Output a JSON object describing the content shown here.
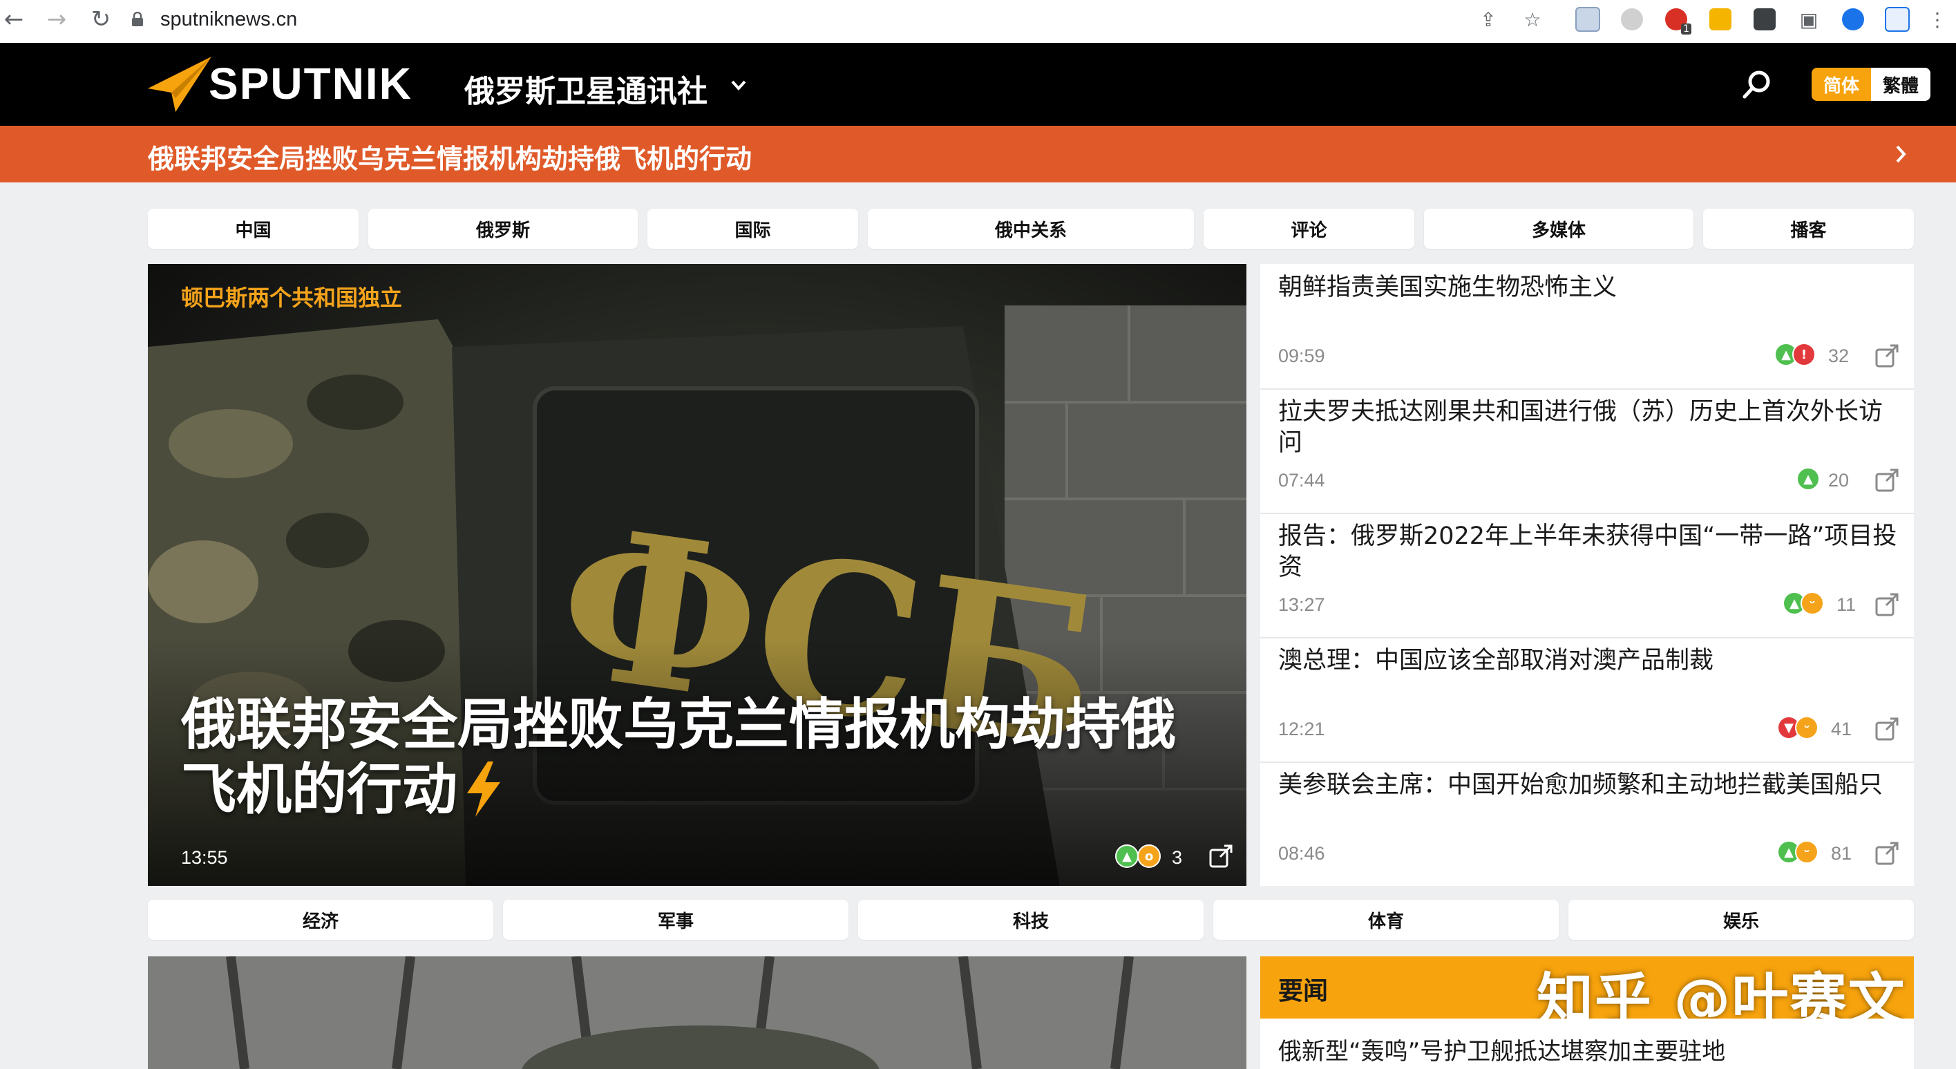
{
  "browser": {
    "url": "sputniknews.cn",
    "extension_badge": "1"
  },
  "header": {
    "logo_text": "SPUTNIK",
    "site_name": "俄罗斯卫星通讯社",
    "lang_simplified": "简体",
    "lang_traditional": "繁體"
  },
  "breaking": {
    "text": "俄联邦安全局挫败乌克兰情报机构劫持俄飞机的行动"
  },
  "tabs_top": [
    "中国",
    "俄罗斯",
    "国际",
    "俄中关系",
    "评论",
    "多媒体",
    "播客"
  ],
  "hero": {
    "kicker": "顿巴斯两个共和国独立",
    "title": "俄联邦安全局挫败乌克兰情报机构劫持俄飞机的行动",
    "time": "13:55",
    "reactions": [
      "like",
      "wow"
    ],
    "count": "3",
    "patch_text": "ФСБ"
  },
  "news_list": [
    {
      "title": "朝鲜指责美国实施生物恐怖主义",
      "time": "09:59",
      "reactions": [
        "like",
        "angry"
      ],
      "count": "32"
    },
    {
      "title": "拉夫罗夫抵达刚果共和国进行俄（苏）历史上首次外长访问",
      "time": "07:44",
      "reactions": [
        "like"
      ],
      "count": "20"
    },
    {
      "title": "报告：俄罗斯2022年上半年未获得中国“一带一路”项目投资",
      "time": "13:27",
      "reactions": [
        "like",
        "laugh"
      ],
      "count": "11"
    },
    {
      "title": "澳总理：中国应该全部取消对澳产品制裁",
      "time": "12:21",
      "reactions": [
        "dislike",
        "laugh"
      ],
      "count": "41"
    },
    {
      "title": "美参联会主席：中国开始愈加频繁和主动地拦截美国船只",
      "time": "08:46",
      "reactions": [
        "like",
        "laugh"
      ],
      "count": "81"
    }
  ],
  "tabs_bottom": [
    "经济",
    "军事",
    "科技",
    "体育",
    "娱乐"
  ],
  "sidebar": {
    "label": "要闻",
    "watermark": "知乎 @叶赛文",
    "first_item": "俄新型“轰鸣”号护卫舰抵达堪察加主要驻地"
  },
  "colors": {
    "accent_orange": "#f7a30d",
    "breaking_red": "#e05a29",
    "header_black": "#000000",
    "page_bg": "#eeeff1"
  }
}
